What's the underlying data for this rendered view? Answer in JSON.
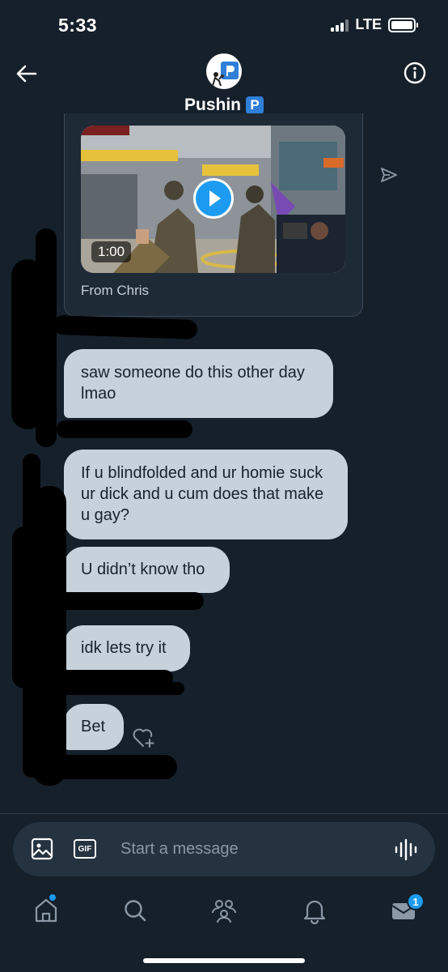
{
  "status_bar": {
    "time": "5:33",
    "network": "LTE"
  },
  "header": {
    "name": "Pushin",
    "badge": "P"
  },
  "video": {
    "duration": "1:00",
    "caption": "From Chris"
  },
  "messages": [
    {
      "text": "saw someone do this other day lmao"
    },
    {
      "text": "If u blindfolded and ur homie suck ur dick and u cum does that make u gay?"
    },
    {
      "text": "U didn’t know tho"
    },
    {
      "text": "idk lets try it"
    },
    {
      "text": "Bet"
    }
  ],
  "compose": {
    "placeholder": "Start a message",
    "gif_label": "GIF"
  },
  "nav": {
    "mail_badge": "1"
  },
  "colors": {
    "background": "#15202b",
    "bubble": "#c6d1dc",
    "accent": "#1d9bf0"
  },
  "icons": [
    "back-arrow-icon",
    "info-icon",
    "send-icon",
    "play-icon",
    "react-heart-icon",
    "image-icon",
    "gif-icon",
    "voice-icon",
    "home-icon",
    "search-icon",
    "communities-icon",
    "notifications-icon",
    "messages-icon"
  ]
}
